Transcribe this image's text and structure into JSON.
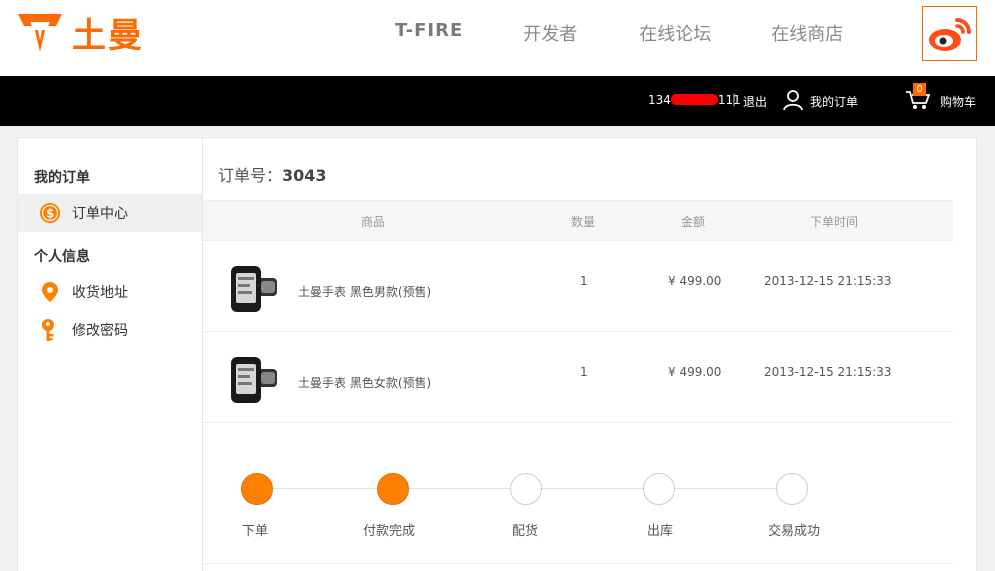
{
  "header": {
    "logo_text": "土曼",
    "nav": [
      "T-FIRE",
      "开发者",
      "在线论坛",
      "在线商店"
    ]
  },
  "userbar": {
    "phone_prefix": "134",
    "phone_suffix": "111",
    "separator": "|",
    "logout": "退出",
    "my_orders": "我的订单",
    "cart_count": "0",
    "cart": "购物车"
  },
  "sidebar": {
    "section1": "我的订单",
    "item_order_center": "订单中心",
    "section2": "个人信息",
    "item_address": "收货地址",
    "item_password": "修改密码"
  },
  "order": {
    "number_label": "订单号：",
    "number": "3043",
    "columns": [
      "商品",
      "数量",
      "金额",
      "下单时间"
    ],
    "rows": [
      {
        "name": "土曼手表 黑色男款(预售)",
        "qty": "1",
        "amount": "¥ 499.00",
        "time": "2013-12-15 21:15:33"
      },
      {
        "name": "土曼手表 黑色女款(预售)",
        "qty": "1",
        "amount": "¥ 499.00",
        "time": "2013-12-15 21:15:33"
      }
    ],
    "steps": [
      {
        "label": "下单",
        "done": true
      },
      {
        "label": "付款完成",
        "done": true
      },
      {
        "label": "配货",
        "done": false
      },
      {
        "label": "出库",
        "done": false
      },
      {
        "label": "交易成功",
        "done": false
      }
    ]
  },
  "colors": {
    "accent": "#ff6a00",
    "step_done": "#ff8000"
  }
}
